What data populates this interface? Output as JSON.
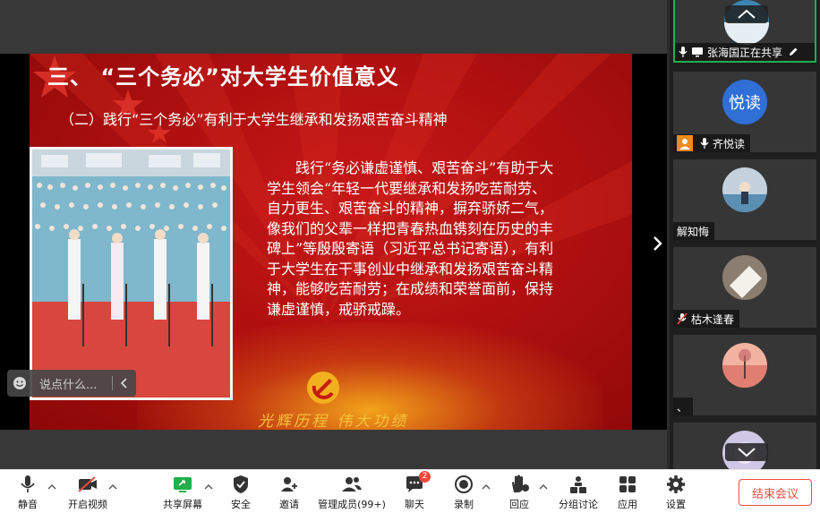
{
  "slide": {
    "title": "三、 “三个务必”对大学生价值意义",
    "subtitle": "（二）践行“三个务必”有利于大学生继承和发扬艰苦奋斗精神",
    "body": "践行“务必谦虚谨慎、艰苦奋斗”有助于大学生领会“年轻一代要继承和发扬吃苦耐劳、自力更生、艰苦奋斗的精神，摒弃骄娇二气，像我们的父辈一样把青春热血镌刻在历史的丰碑上”等殷殷寄语（习近平总书记寄语），有利于大学生在干事创业中继承和发扬艰苦奋斗精神，能够吃苦耐劳；在成绩和荣誉面前，保持谦虚谨慎，戒骄戒躁。",
    "slogan": "光辉历程  伟大功绩"
  },
  "comment": {
    "placeholder": "说点什么..."
  },
  "participants": [
    {
      "name": "张海国正在共享",
      "avatar_text": "",
      "avatar_color": "#2e6f99"
    },
    {
      "name": "齐悦读",
      "avatar_text": "悦读",
      "avatar_color": "#2f6fd6"
    },
    {
      "name": "解知悔",
      "avatar_text": "",
      "avatar_color": "#b9c7d4"
    },
    {
      "name": "枯木逢春",
      "avatar_text": "",
      "avatar_color": "#d8cfc5"
    },
    {
      "name": "、",
      "avatar_text": "",
      "avatar_color": "#e8a08b"
    },
    {
      "name": "",
      "avatar_text": "",
      "avatar_color": "#c9c2e0"
    }
  ],
  "toolbar": {
    "mute": "静音",
    "video": "开启视频",
    "share": "共享屏幕",
    "security": "安全",
    "invite": "邀请",
    "members": "管理成员(99+)",
    "chat": "聊天",
    "chat_badge": "2",
    "record": "录制",
    "reaction": "回应",
    "breakout": "分组讨论",
    "apps": "应用",
    "settings": "设置",
    "end": "结束会议"
  },
  "colors": {
    "accent_green": "#1fb04a",
    "end_red": "#f04a3e",
    "slide_red": "#b01010",
    "gold": "#f6c23b"
  }
}
